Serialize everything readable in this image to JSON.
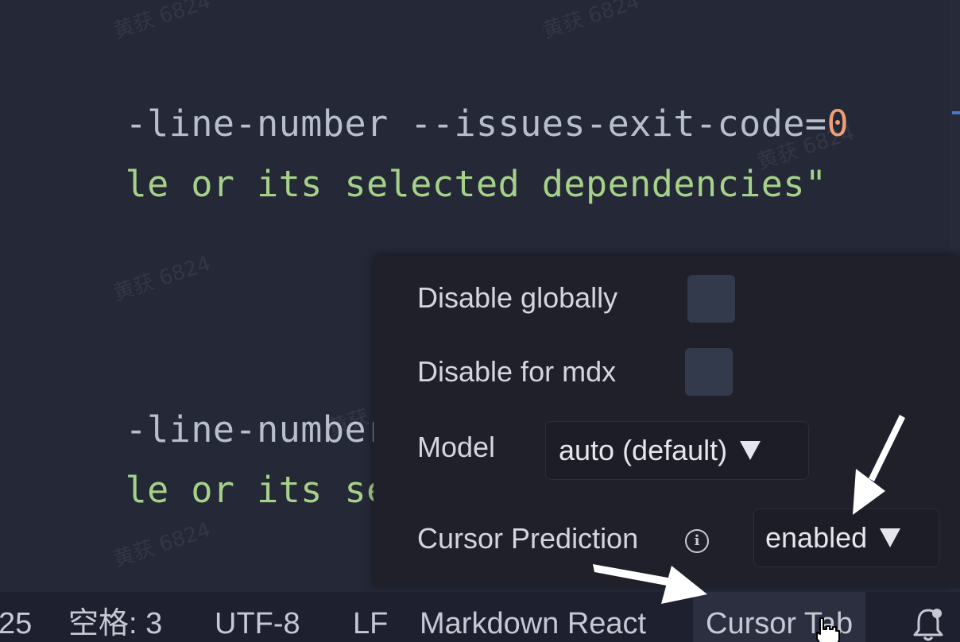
{
  "editor": {
    "lines": [
      {
        "tokens": [
          {
            "text": "-line-number --issues-exit-code=",
            "kind": "default"
          },
          {
            "text": "0",
            "kind": "number"
          }
        ]
      },
      {
        "tokens": [
          {
            "text": "le or its selected dependencies\"",
            "kind": "string"
          }
        ]
      },
      {
        "tokens": [
          {
            "text": "-line-number --i",
            "kind": "default"
          }
        ]
      },
      {
        "tokens": [
          {
            "text": "le or its select",
            "kind": "string"
          }
        ]
      }
    ]
  },
  "watermark_text": "黄获 6824",
  "popup": {
    "disable_globally_label": "Disable globally",
    "disable_for_mdx_label": "Disable for mdx",
    "model_label": "Model",
    "model_value": "auto (default)",
    "cursor_prediction_label": "Cursor Prediction",
    "cursor_prediction_value": "enabled",
    "info_icon_glyph": "i",
    "disable_globally_checked": false,
    "disable_for_mdx_checked": false
  },
  "statusbar": {
    "line_col": "25",
    "indent": "空格: 3",
    "encoding": "UTF-8",
    "eol": "LF",
    "language": "Markdown React",
    "cursor_tab": "Cursor Tab"
  },
  "icons": {
    "info": "info-icon",
    "bell": "bell-icon",
    "caret": "caret-down-icon",
    "hand": "hand-pointer-icon"
  },
  "colors": {
    "editor_bg": "#242837",
    "code_default": "#b8bfcc",
    "code_string": "#a6d189",
    "code_number": "#ef9f76",
    "popup_bg": "#1f2029",
    "checkbox": "#333a4c",
    "statusbar_bg": "#1e2030"
  }
}
